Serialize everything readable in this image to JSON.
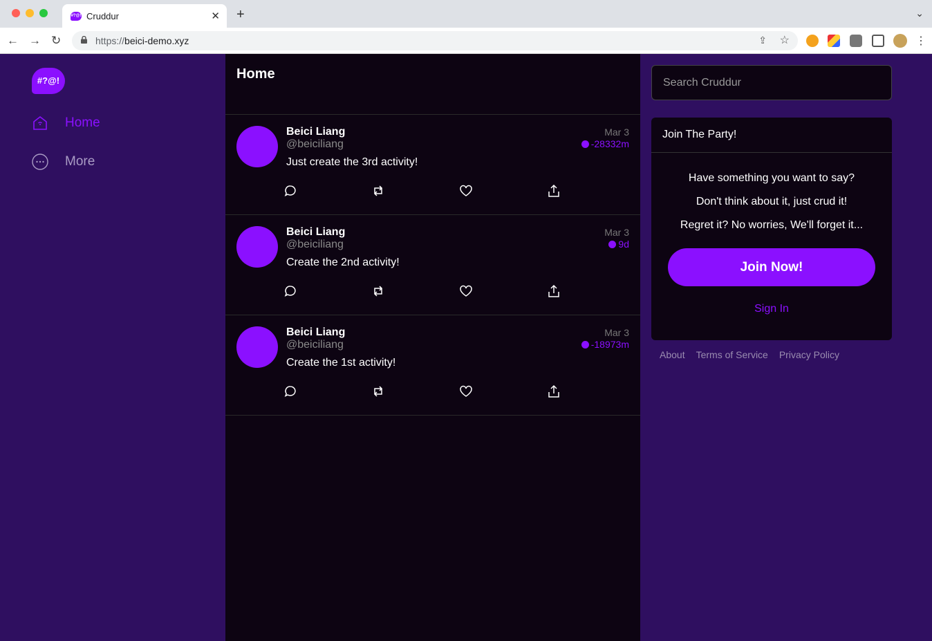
{
  "browser": {
    "tab_title": "Cruddur",
    "tab_favicon_text": "#?@!",
    "url_prefix": "https://",
    "url_host": "beici-demo.xyz",
    "traffic_lights": [
      "#ff5f57",
      "#febc2e",
      "#28c840"
    ]
  },
  "sidebar": {
    "logo_text": "#?@!",
    "items": [
      {
        "label": "Home",
        "icon": "home-icon",
        "active": true
      },
      {
        "label": "More",
        "icon": "more-icon",
        "active": false
      }
    ]
  },
  "feed": {
    "title": "Home",
    "posts": [
      {
        "name": "Beici Liang",
        "handle": "@beiciliang",
        "text": "Just create the 3rd activity!",
        "date": "Mar 3",
        "expires": "-28332m"
      },
      {
        "name": "Beici Liang",
        "handle": "@beiciliang",
        "text": "Create the 2nd activity!",
        "date": "Mar 3",
        "expires": "9d"
      },
      {
        "name": "Beici Liang",
        "handle": "@beiciliang",
        "text": "Create the 1st activity!",
        "date": "Mar 3",
        "expires": "-18973m"
      }
    ]
  },
  "search": {
    "placeholder": "Search Cruddur"
  },
  "join_panel": {
    "title": "Join The Party!",
    "lines": [
      "Have something you want to say?",
      "Don't think about it, just crud it!",
      "Regret it? No worries, We'll forget it..."
    ],
    "join_label": "Join Now!",
    "signin_label": "Sign In"
  },
  "footer": {
    "links": [
      "About",
      "Terms of Service",
      "Privacy Policy"
    ]
  },
  "colors": {
    "accent": "#8b10ff",
    "sidebar_bg": "#2f0f60",
    "feed_bg": "#0d0412"
  }
}
